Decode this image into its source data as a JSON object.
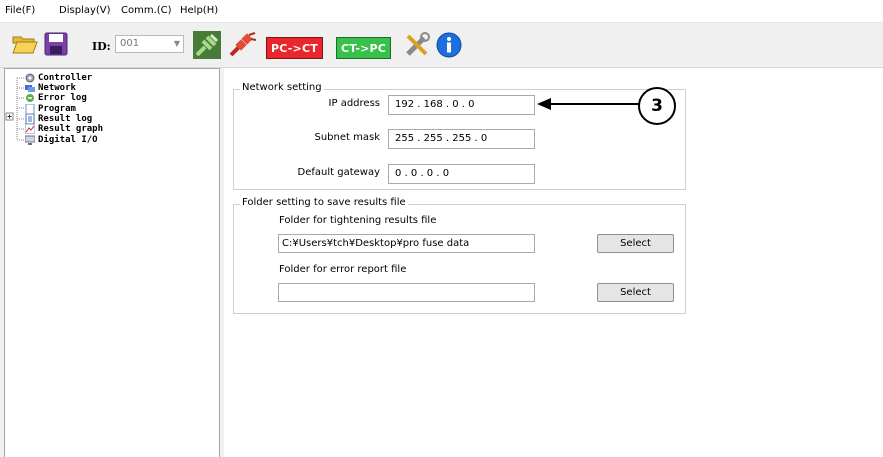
{
  "menu": [
    "File(F)",
    "Display(V)",
    "Comm.(C)",
    "Help(H)"
  ],
  "toolbar": {
    "id_label": "ID:",
    "id_value": "001",
    "pc_to_ct": "PC->CT",
    "ct_to_pc": "CT->PC",
    "colors": {
      "pc_to_ct_bg": "#e8262b",
      "ct_to_pc_bg": "#37c14a",
      "info_blue": "#1d6fe0"
    }
  },
  "tree": {
    "items": [
      "Controller",
      "Network",
      "Error log",
      "Program",
      "Result log",
      "Result graph",
      "Digital I/O"
    ]
  },
  "network": {
    "title": "Network setting",
    "ip_label": "IP address",
    "ip_value": "192 . 168 .  0  .  0",
    "subnet_label": "Subnet mask",
    "subnet_value": "255 . 255 . 255 .  0",
    "gateway_label": "Default gateway",
    "gateway_value": " 0  .  0  .  0  .  0"
  },
  "folder": {
    "title": "Folder setting to save results file",
    "tightening_label": "Folder for tightening results file",
    "tightening_value": "C:¥Users¥tch¥Desktop¥pro fuse data",
    "error_label": "Folder for error report file",
    "error_value": "",
    "select_label_1": "Select",
    "select_label_2": "Select"
  },
  "annotation": {
    "number": "3"
  }
}
